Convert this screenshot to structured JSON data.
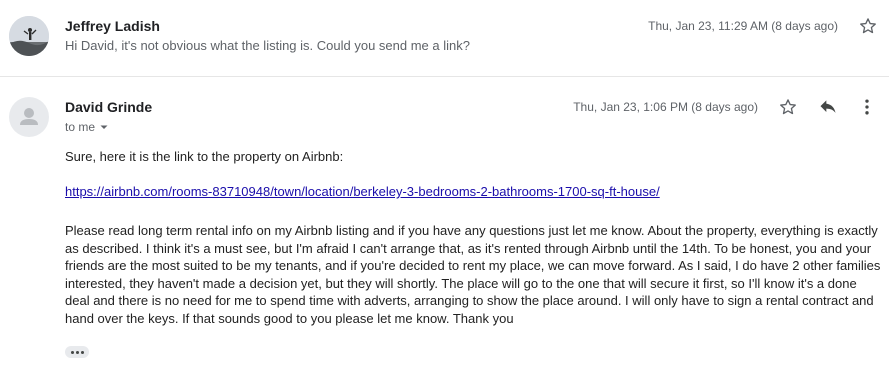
{
  "messages": [
    {
      "sender": "Jeffrey Ladish",
      "snippet": "Hi David, it's not obvious what the listing is. Could you send me a link?",
      "date": "Thu, Jan 23, 11:29 AM (8 days ago)"
    },
    {
      "sender": "David Grinde",
      "recipient": "to me",
      "date": "Thu, Jan 23, 1:06 PM (8 days ago)",
      "greeting": "Sure, here it is the link to the property on Airbnb:",
      "link": "https://airbnb.com/rooms-83710948/town/location/berkeley-3-bedrooms-2-bathrooms-1700-sq-ft-house/",
      "paragraph": "Please read long term rental info on my Airbnb listing and if you have any questions just let me know. About the property, everything is exactly as described. I think it's a must see, but I'm afraid I can't arrange that, as it's rented through Airbnb until the 14th. To be honest, you and your friends are the most suited to be my tenants, and if you're decided to rent my place, we can move forward. As I said, I do have 2 other families interested, they haven't made a decision yet, but they will shortly. The place will go to the one that will secure it first, so I'll know it's a done deal and there is no need for me to spend time with adverts, arranging to show the place around. I will only have to sign a rental contract and hand over the keys. If that sounds good to you please let me know. Thank you"
    }
  ],
  "icons": {
    "star": "star-icon",
    "reply": "reply-icon",
    "more": "more-vertical-icon",
    "dropdown": "chevron-down-icon",
    "show_trimmed": "ellipsis-icon"
  },
  "colors": {
    "link": "#1a0dab",
    "secondary_text": "#5f6368",
    "divider": "#e6e6e6"
  }
}
